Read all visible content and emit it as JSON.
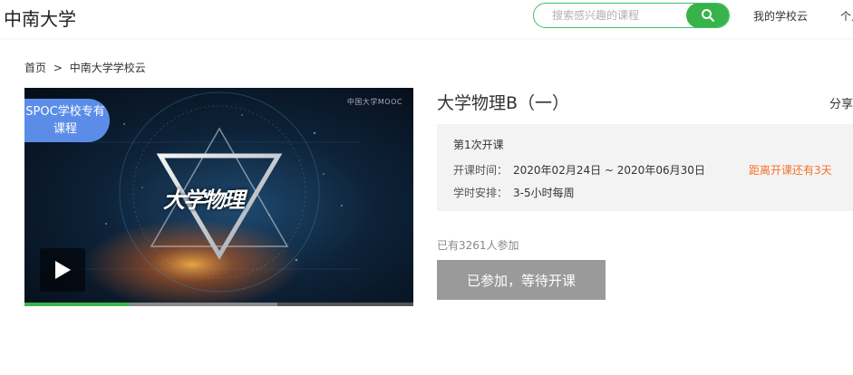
{
  "header": {
    "school_name": "中南大学",
    "search_placeholder": "搜索感兴趣的课程",
    "nav": {
      "my_school_cloud": "我的学校云",
      "personal": "个人"
    }
  },
  "breadcrumb": {
    "home": "首页",
    "separator": ">",
    "current": "中南大学学校云"
  },
  "video": {
    "badge_line1": "SPOC学校专有",
    "badge_line2": "课程",
    "logo_text": "中国大学MOOC",
    "cover_title": "大学物理",
    "progress_played": 0.27,
    "progress_buffered": 0.65
  },
  "course": {
    "title": "大学物理B（一）",
    "share_label": "分享",
    "session": "第1次开课",
    "time_label": "开课时间：",
    "time_value": "2020年02月24日 ~ 2020年06月30日",
    "countdown": "距离开课还有3天",
    "hours_label": "学时安排：",
    "hours_value": "3-5小时每周",
    "enrolled": "已有3261人参加",
    "join_button": "已参加，等待开课"
  },
  "colors": {
    "accent_green": "#37b34a",
    "badge_blue": "#5b8de8",
    "countdown_orange": "#f5722c",
    "disabled_button": "#9a9a9a"
  }
}
